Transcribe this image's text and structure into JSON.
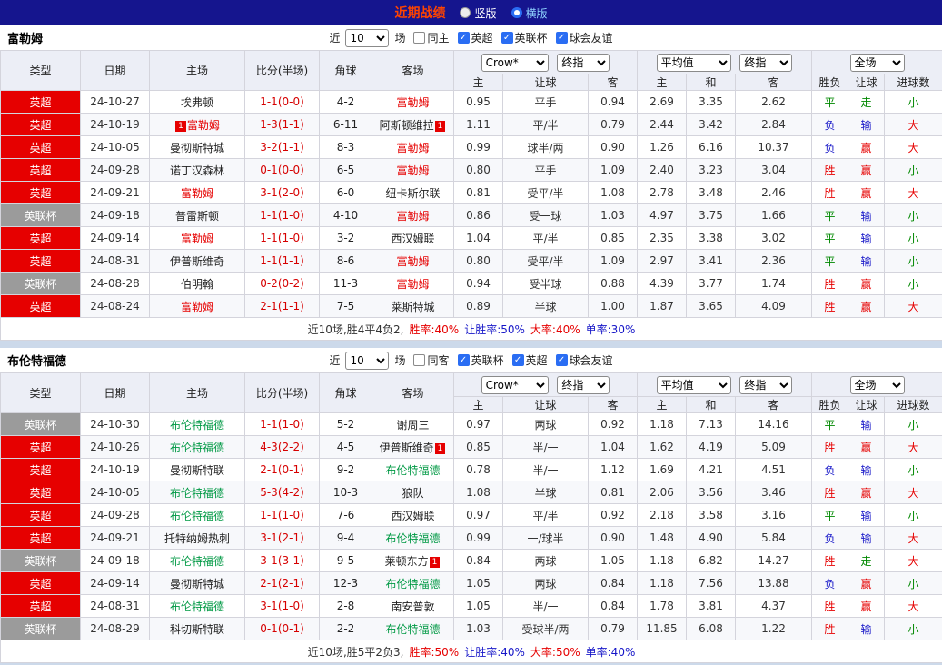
{
  "topbar": {
    "title": "近期战绩",
    "radios": [
      {
        "label": "竖版",
        "selected": false
      },
      {
        "label": "横版",
        "selected": true
      }
    ]
  },
  "labels": {
    "near": "近",
    "matches": "场",
    "col_type": "类型",
    "col_date": "日期",
    "col_home": "主场",
    "col_score": "比分(半场)",
    "col_corner": "角球",
    "col_away": "客场",
    "asian_home": "主",
    "asian_hcap": "让球",
    "asian_away": "客",
    "euro_home": "主",
    "euro_draw": "和",
    "euro_away": "客",
    "res_wdl": "胜负",
    "res_hcap": "让球",
    "res_goals": "进球数",
    "dd_bookmaker": "Crow*",
    "dd_final": "终指",
    "dd_average": "平均值",
    "dd_full": "全场"
  },
  "colors": {
    "league_epl_bg": "#e60000",
    "league_cup_bg": "#9b9b9b",
    "home_focus": "#e60000",
    "away_focus": "#009944",
    "topbar_bg": "#15158e",
    "title_text": "#ff4400"
  },
  "sections": [
    {
      "team": "富勒姆",
      "team_color": "#e60000",
      "count": "10",
      "filters": [
        {
          "label": "同主",
          "checked": false
        },
        {
          "label": "英超",
          "checked": true
        },
        {
          "label": "英联杯",
          "checked": true
        },
        {
          "label": "球会友谊",
          "checked": true
        }
      ],
      "rows": [
        {
          "league": "英超",
          "date": "24-10-27",
          "home": {
            "name": "埃弗顿"
          },
          "score": "1-1(0-0)",
          "corners": "4-2",
          "away": {
            "name": "富勒姆",
            "focus": true
          },
          "odds": [
            "0.95",
            "平手",
            "0.94",
            "2.69",
            "3.35",
            "2.62"
          ],
          "results": [
            {
              "t": "平",
              "c": "green"
            },
            {
              "t": "走",
              "c": "green"
            },
            {
              "t": "小",
              "c": "green"
            }
          ]
        },
        {
          "league": "英超",
          "date": "24-10-19",
          "home": {
            "name": "富勒姆",
            "focus": true,
            "card_before": "1"
          },
          "score": "1-3(1-1)",
          "corners": "6-11",
          "away": {
            "name": "阿斯顿维拉",
            "card_after": "1"
          },
          "odds": [
            "1.11",
            "平/半",
            "0.79",
            "2.44",
            "3.42",
            "2.84"
          ],
          "results": [
            {
              "t": "负",
              "c": "blue"
            },
            {
              "t": "输",
              "c": "blue"
            },
            {
              "t": "大",
              "c": "red"
            }
          ]
        },
        {
          "league": "英超",
          "date": "24-10-05",
          "home": {
            "name": "曼彻斯特城"
          },
          "score": "3-2(1-1)",
          "corners": "8-3",
          "away": {
            "name": "富勒姆",
            "focus": true
          },
          "odds": [
            "0.99",
            "球半/两",
            "0.90",
            "1.26",
            "6.16",
            "10.37"
          ],
          "results": [
            {
              "t": "负",
              "c": "blue"
            },
            {
              "t": "赢",
              "c": "red"
            },
            {
              "t": "大",
              "c": "red"
            }
          ]
        },
        {
          "league": "英超",
          "date": "24-09-28",
          "home": {
            "name": "诺丁汉森林"
          },
          "score": "0-1(0-0)",
          "corners": "6-5",
          "away": {
            "name": "富勒姆",
            "focus": true
          },
          "odds": [
            "0.80",
            "平手",
            "1.09",
            "2.40",
            "3.23",
            "3.04"
          ],
          "results": [
            {
              "t": "胜",
              "c": "red"
            },
            {
              "t": "赢",
              "c": "red"
            },
            {
              "t": "小",
              "c": "green"
            }
          ]
        },
        {
          "league": "英超",
          "date": "24-09-21",
          "home": {
            "name": "富勒姆",
            "focus": true
          },
          "score": "3-1(2-0)",
          "corners": "6-0",
          "away": {
            "name": "纽卡斯尔联"
          },
          "odds": [
            "0.81",
            "受平/半",
            "1.08",
            "2.78",
            "3.48",
            "2.46"
          ],
          "results": [
            {
              "t": "胜",
              "c": "red"
            },
            {
              "t": "赢",
              "c": "red"
            },
            {
              "t": "大",
              "c": "red"
            }
          ]
        },
        {
          "league": "英联杯",
          "date": "24-09-18",
          "home": {
            "name": "普雷斯顿"
          },
          "score": "1-1(1-0)",
          "corners": "4-10",
          "away": {
            "name": "富勒姆",
            "focus": true
          },
          "odds": [
            "0.86",
            "受一球",
            "1.03",
            "4.97",
            "3.75",
            "1.66"
          ],
          "results": [
            {
              "t": "平",
              "c": "green"
            },
            {
              "t": "输",
              "c": "blue"
            },
            {
              "t": "小",
              "c": "green"
            }
          ]
        },
        {
          "league": "英超",
          "date": "24-09-14",
          "home": {
            "name": "富勒姆",
            "focus": true
          },
          "score": "1-1(1-0)",
          "corners": "3-2",
          "away": {
            "name": "西汉姆联"
          },
          "odds": [
            "1.04",
            "平/半",
            "0.85",
            "2.35",
            "3.38",
            "3.02"
          ],
          "results": [
            {
              "t": "平",
              "c": "green"
            },
            {
              "t": "输",
              "c": "blue"
            },
            {
              "t": "小",
              "c": "green"
            }
          ]
        },
        {
          "league": "英超",
          "date": "24-08-31",
          "home": {
            "name": "伊普斯维奇"
          },
          "score": "1-1(1-1)",
          "corners": "8-6",
          "away": {
            "name": "富勒姆",
            "focus": true
          },
          "odds": [
            "0.80",
            "受平/半",
            "1.09",
            "2.97",
            "3.41",
            "2.36"
          ],
          "results": [
            {
              "t": "平",
              "c": "green"
            },
            {
              "t": "输",
              "c": "blue"
            },
            {
              "t": "小",
              "c": "green"
            }
          ]
        },
        {
          "league": "英联杯",
          "date": "24-08-28",
          "home": {
            "name": "伯明翰"
          },
          "score": "0-2(0-2)",
          "corners": "11-3",
          "away": {
            "name": "富勒姆",
            "focus": true
          },
          "odds": [
            "0.94",
            "受半球",
            "0.88",
            "4.39",
            "3.77",
            "1.74"
          ],
          "results": [
            {
              "t": "胜",
              "c": "red"
            },
            {
              "t": "赢",
              "c": "red"
            },
            {
              "t": "小",
              "c": "green"
            }
          ]
        },
        {
          "league": "英超",
          "date": "24-08-24",
          "home": {
            "name": "富勒姆",
            "focus": true
          },
          "score": "2-1(1-1)",
          "corners": "7-5",
          "away": {
            "name": "莱斯特城"
          },
          "odds": [
            "0.89",
            "半球",
            "1.00",
            "1.87",
            "3.65",
            "4.09"
          ],
          "results": [
            {
              "t": "胜",
              "c": "red"
            },
            {
              "t": "赢",
              "c": "red"
            },
            {
              "t": "大",
              "c": "red"
            }
          ]
        }
      ],
      "summary": [
        {
          "t": "近10场,胜4平4负2,",
          "c": "dark"
        },
        {
          "t": "胜率:40%",
          "c": "red"
        },
        {
          "t": "让胜率:50%",
          "c": "blue"
        },
        {
          "t": "大率:40%",
          "c": "red"
        },
        {
          "t": "单率:30%",
          "c": "blue"
        }
      ]
    },
    {
      "team": "布伦特福德",
      "team_color": "#009944",
      "count": "10",
      "filters": [
        {
          "label": "同客",
          "checked": false
        },
        {
          "label": "英联杯",
          "checked": true
        },
        {
          "label": "英超",
          "checked": true
        },
        {
          "label": "球会友谊",
          "checked": true
        }
      ],
      "rows": [
        {
          "league": "英联杯",
          "date": "24-10-30",
          "home": {
            "name": "布伦特福德",
            "focus": true
          },
          "score": "1-1(1-0)",
          "corners": "5-2",
          "away": {
            "name": "谢周三"
          },
          "odds": [
            "0.97",
            "两球",
            "0.92",
            "1.18",
            "7.13",
            "14.16"
          ],
          "results": [
            {
              "t": "平",
              "c": "green"
            },
            {
              "t": "输",
              "c": "blue"
            },
            {
              "t": "小",
              "c": "green"
            }
          ]
        },
        {
          "league": "英超",
          "date": "24-10-26",
          "home": {
            "name": "布伦特福德",
            "focus": true
          },
          "score": "4-3(2-2)",
          "corners": "4-5",
          "away": {
            "name": "伊普斯维奇",
            "card_after": "1"
          },
          "odds": [
            "0.85",
            "半/一",
            "1.04",
            "1.62",
            "4.19",
            "5.09"
          ],
          "results": [
            {
              "t": "胜",
              "c": "red"
            },
            {
              "t": "赢",
              "c": "red"
            },
            {
              "t": "大",
              "c": "red"
            }
          ]
        },
        {
          "league": "英超",
          "date": "24-10-19",
          "home": {
            "name": "曼彻斯特联"
          },
          "score": "2-1(0-1)",
          "corners": "9-2",
          "away": {
            "name": "布伦特福德",
            "focus": true
          },
          "odds": [
            "0.78",
            "半/一",
            "1.12",
            "1.69",
            "4.21",
            "4.51"
          ],
          "results": [
            {
              "t": "负",
              "c": "blue"
            },
            {
              "t": "输",
              "c": "blue"
            },
            {
              "t": "小",
              "c": "green"
            }
          ]
        },
        {
          "league": "英超",
          "date": "24-10-05",
          "home": {
            "name": "布伦特福德",
            "focus": true
          },
          "score": "5-3(4-2)",
          "corners": "10-3",
          "away": {
            "name": "狼队"
          },
          "odds": [
            "1.08",
            "半球",
            "0.81",
            "2.06",
            "3.56",
            "3.46"
          ],
          "results": [
            {
              "t": "胜",
              "c": "red"
            },
            {
              "t": "赢",
              "c": "red"
            },
            {
              "t": "大",
              "c": "red"
            }
          ]
        },
        {
          "league": "英超",
          "date": "24-09-28",
          "home": {
            "name": "布伦特福德",
            "focus": true
          },
          "score": "1-1(1-0)",
          "corners": "7-6",
          "away": {
            "name": "西汉姆联"
          },
          "odds": [
            "0.97",
            "平/半",
            "0.92",
            "2.18",
            "3.58",
            "3.16"
          ],
          "results": [
            {
              "t": "平",
              "c": "green"
            },
            {
              "t": "输",
              "c": "blue"
            },
            {
              "t": "小",
              "c": "green"
            }
          ]
        },
        {
          "league": "英超",
          "date": "24-09-21",
          "home": {
            "name": "托特纳姆热刺"
          },
          "score": "3-1(2-1)",
          "corners": "9-4",
          "away": {
            "name": "布伦特福德",
            "focus": true
          },
          "odds": [
            "0.99",
            "一/球半",
            "0.90",
            "1.48",
            "4.90",
            "5.84"
          ],
          "results": [
            {
              "t": "负",
              "c": "blue"
            },
            {
              "t": "输",
              "c": "blue"
            },
            {
              "t": "大",
              "c": "red"
            }
          ]
        },
        {
          "league": "英联杯",
          "date": "24-09-18",
          "home": {
            "name": "布伦特福德",
            "focus": true
          },
          "score": "3-1(3-1)",
          "corners": "9-5",
          "away": {
            "name": "莱顿东方",
            "card_after": "1"
          },
          "odds": [
            "0.84",
            "两球",
            "1.05",
            "1.18",
            "6.82",
            "14.27"
          ],
          "results": [
            {
              "t": "胜",
              "c": "red"
            },
            {
              "t": "走",
              "c": "green"
            },
            {
              "t": "大",
              "c": "red"
            }
          ]
        },
        {
          "league": "英超",
          "date": "24-09-14",
          "home": {
            "name": "曼彻斯特城"
          },
          "score": "2-1(2-1)",
          "corners": "12-3",
          "away": {
            "name": "布伦特福德",
            "focus": true
          },
          "odds": [
            "1.05",
            "两球",
            "0.84",
            "1.18",
            "7.56",
            "13.88"
          ],
          "results": [
            {
              "t": "负",
              "c": "blue"
            },
            {
              "t": "赢",
              "c": "red"
            },
            {
              "t": "小",
              "c": "green"
            }
          ]
        },
        {
          "league": "英超",
          "date": "24-08-31",
          "home": {
            "name": "布伦特福德",
            "focus": true
          },
          "score": "3-1(1-0)",
          "corners": "2-8",
          "away": {
            "name": "南安普敦"
          },
          "odds": [
            "1.05",
            "半/一",
            "0.84",
            "1.78",
            "3.81",
            "4.37"
          ],
          "results": [
            {
              "t": "胜",
              "c": "red"
            },
            {
              "t": "赢",
              "c": "red"
            },
            {
              "t": "大",
              "c": "red"
            }
          ]
        },
        {
          "league": "英联杯",
          "date": "24-08-29",
          "home": {
            "name": "科切斯特联"
          },
          "score": "0-1(0-1)",
          "corners": "2-2",
          "away": {
            "name": "布伦特福德",
            "focus": true
          },
          "odds": [
            "1.03",
            "受球半/两",
            "0.79",
            "11.85",
            "6.08",
            "1.22"
          ],
          "results": [
            {
              "t": "胜",
              "c": "red"
            },
            {
              "t": "输",
              "c": "blue"
            },
            {
              "t": "小",
              "c": "green"
            }
          ]
        }
      ],
      "summary": [
        {
          "t": "近10场,胜5平2负3,",
          "c": "dark"
        },
        {
          "t": "胜率:50%",
          "c": "red"
        },
        {
          "t": "让胜率:40%",
          "c": "blue"
        },
        {
          "t": "大率:50%",
          "c": "red"
        },
        {
          "t": "单率:40%",
          "c": "blue"
        }
      ]
    }
  ]
}
